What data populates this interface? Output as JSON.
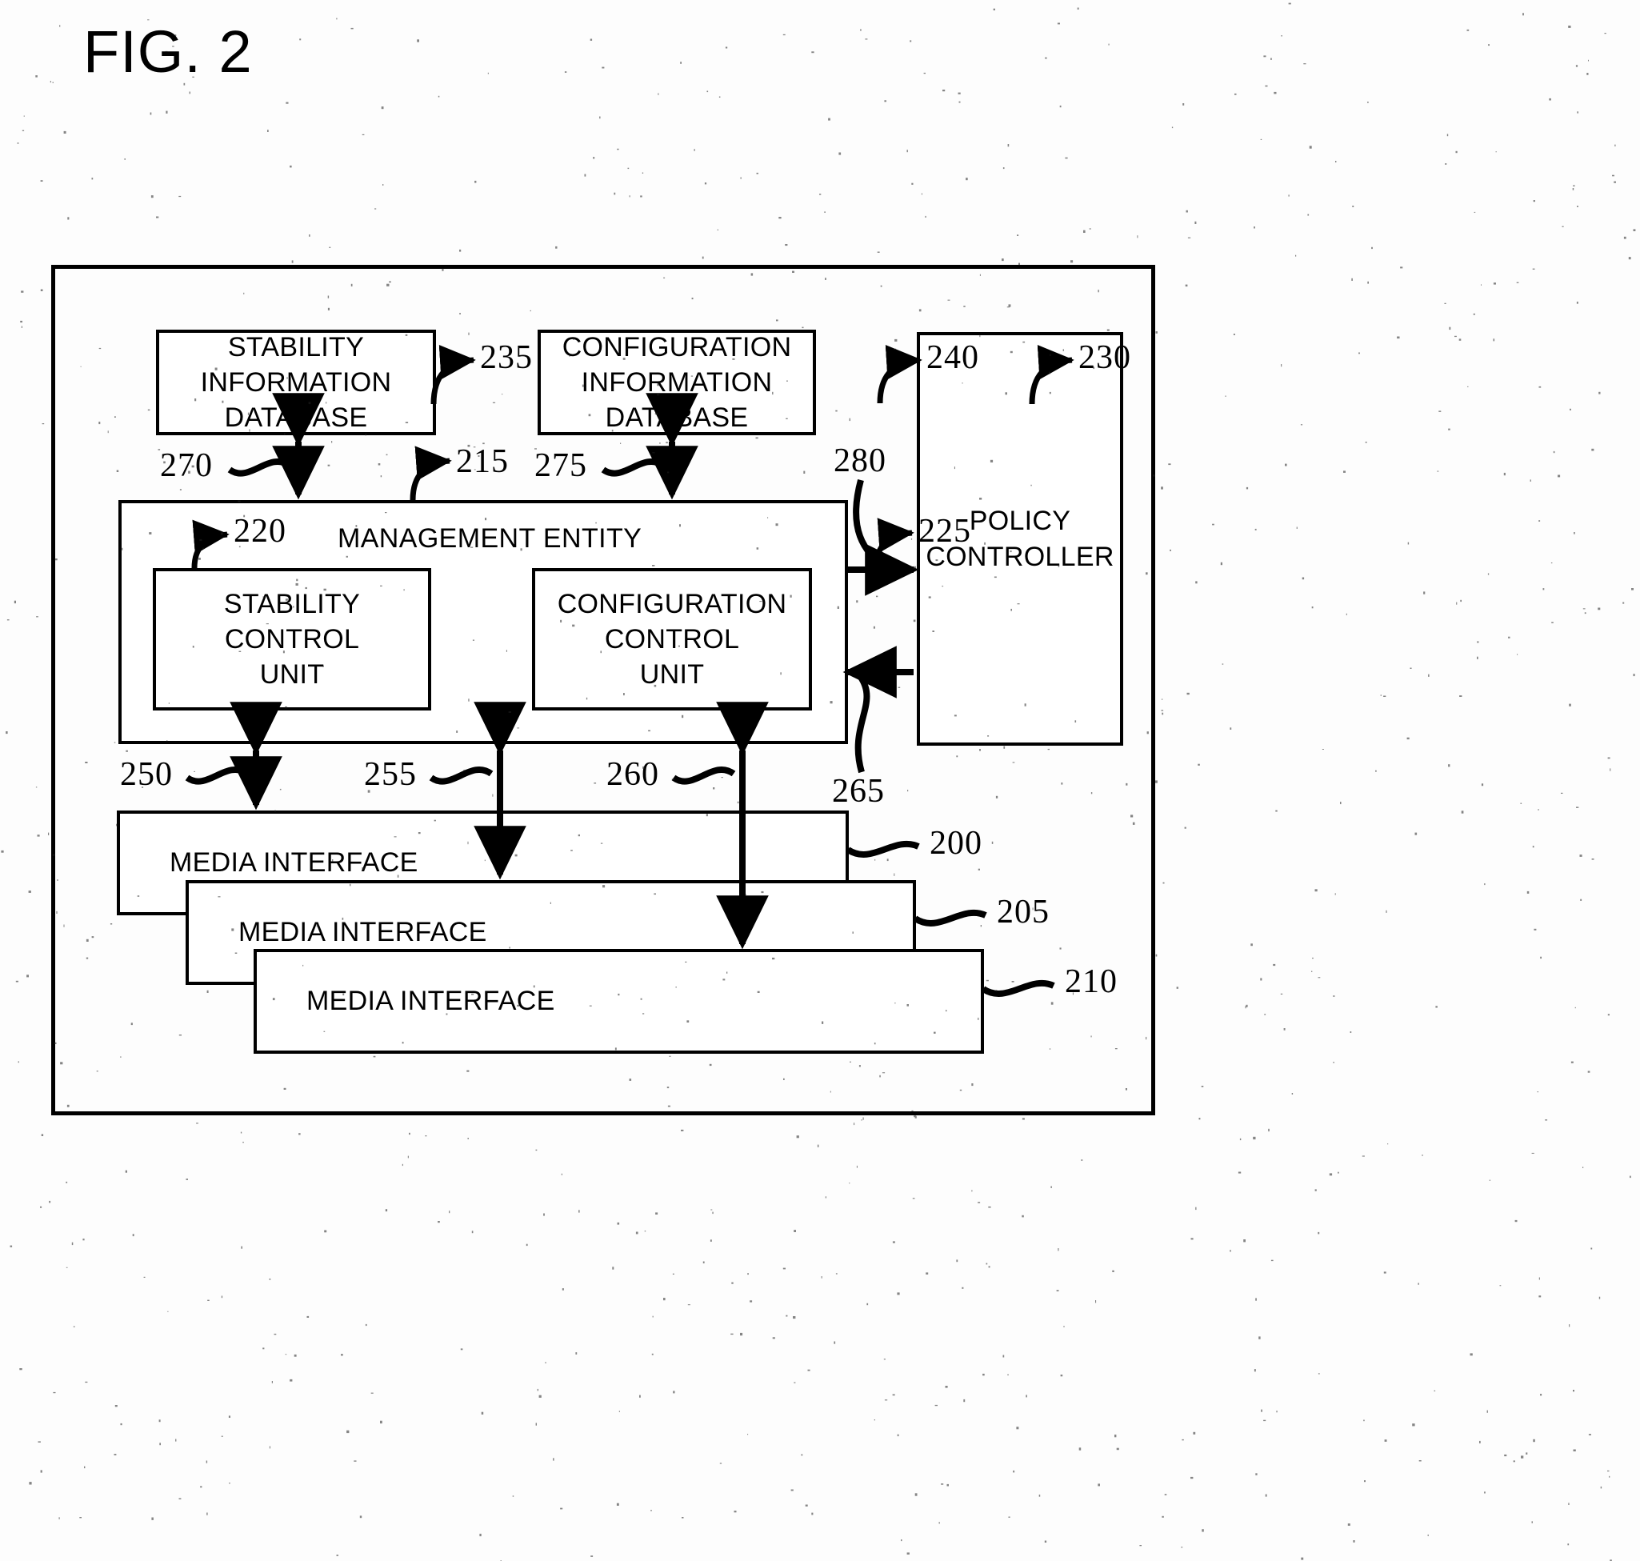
{
  "figure": {
    "title": "FIG. 2"
  },
  "boxes": {
    "stability_information_database": {
      "lines": [
        "STABILITY",
        "INFORMATION",
        "DATABASE"
      ],
      "ref": "235"
    },
    "configuration_information_database": {
      "lines": [
        "CONFIGURATION",
        "INFORMATION",
        "DATABASE"
      ],
      "ref": "240"
    },
    "policy_controller": {
      "lines": [
        "POLICY",
        "CONTROLLER"
      ],
      "ref": "230"
    },
    "management_entity": {
      "title": "MANAGEMENT ENTITY",
      "ref": "215"
    },
    "stability_control_unit": {
      "lines": [
        "STABILITY",
        "CONTROL",
        "UNIT"
      ],
      "ref": "220"
    },
    "configuration_control_unit": {
      "lines": [
        "CONFIGURATION",
        "CONTROL",
        "UNIT"
      ],
      "ref": "225"
    },
    "media_interface_1": {
      "label": "MEDIA INTERFACE",
      "ref": "200"
    },
    "media_interface_2": {
      "label": "MEDIA INTERFACE",
      "ref": "205"
    },
    "media_interface_3": {
      "label": "MEDIA INTERFACE",
      "ref": "210"
    }
  },
  "connector_refs": {
    "stability_db_link": "270",
    "configuration_db_link": "275",
    "media_link_1": "250",
    "media_link_2": "255",
    "media_link_3": "260",
    "policy_in_link": "280",
    "policy_out_link": "265"
  },
  "colors": {
    "ink": "#000000",
    "paper": "#ffffff"
  }
}
